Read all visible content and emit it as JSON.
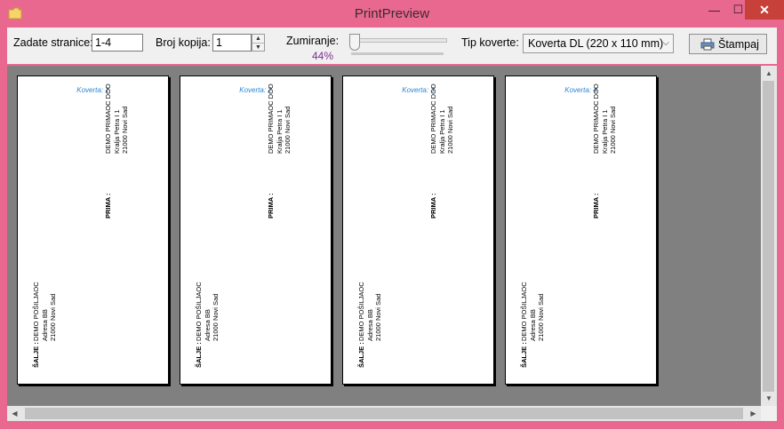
{
  "window": {
    "title": "PrintPreview",
    "minimize": "—",
    "maximize": "☐",
    "close": "✕"
  },
  "toolbar": {
    "pages_label": "Zadate stranice:",
    "pages_value": "1-4",
    "copies_label": "Broj kopija:",
    "copies_value": "1",
    "zoom_label": "Zumiranje:",
    "zoom_value": "44%",
    "zoom_level": 0.0,
    "envelope_label": "Tip koverte:",
    "envelope_value": "Koverta DL (220 x 110 mm)",
    "print_label": "Štampaj"
  },
  "pages": [
    {
      "title": "Koverta: 1",
      "recipient": {
        "label": "PRIMA :",
        "lines": [
          "DEMO PRIMAOC DOO",
          "Kralja Petra I 1",
          "21000  Novi Sad"
        ]
      },
      "sender": {
        "label": "ŠALJE :",
        "lines": [
          "DEMO POŠILJAOC",
          "Adresa BB",
          "21000 Novi Sad"
        ]
      }
    },
    {
      "title": "Koverta: 2",
      "recipient": {
        "label": "PRIMA :",
        "lines": [
          "DEMO PRIMAOC DOO",
          "Kralja Petra I 1",
          "21000  Novi Sad"
        ]
      },
      "sender": {
        "label": "ŠALJE :",
        "lines": [
          "DEMO POŠILJAOC",
          "Adresa BB",
          "21000 Novi Sad"
        ]
      }
    },
    {
      "title": "Koverta: 3",
      "recipient": {
        "label": "PRIMA :",
        "lines": [
          "DEMO PRIMAOC DOO",
          "Kralja Petra I 1",
          "21000  Novi Sad"
        ]
      },
      "sender": {
        "label": "ŠALJE :",
        "lines": [
          "DEMO POŠILJAOC",
          "Adresa BB",
          "21000 Novi Sad"
        ]
      }
    },
    {
      "title": "Koverta: 4",
      "recipient": {
        "label": "PRIMA :",
        "lines": [
          "DEMO PRIMAOC DOO",
          "Kralja Petra I 1",
          "21000  Novi Sad"
        ]
      },
      "sender": {
        "label": "ŠALJE :",
        "lines": [
          "DEMO POŠILJAOC",
          "Adresa BB",
          "21000 Novi Sad"
        ]
      }
    }
  ],
  "colors": {
    "titlebar": "#e9688f",
    "page_title": "#2b86d2",
    "zoom_value": "#7b2f8f",
    "preview_bg": "#808080"
  }
}
